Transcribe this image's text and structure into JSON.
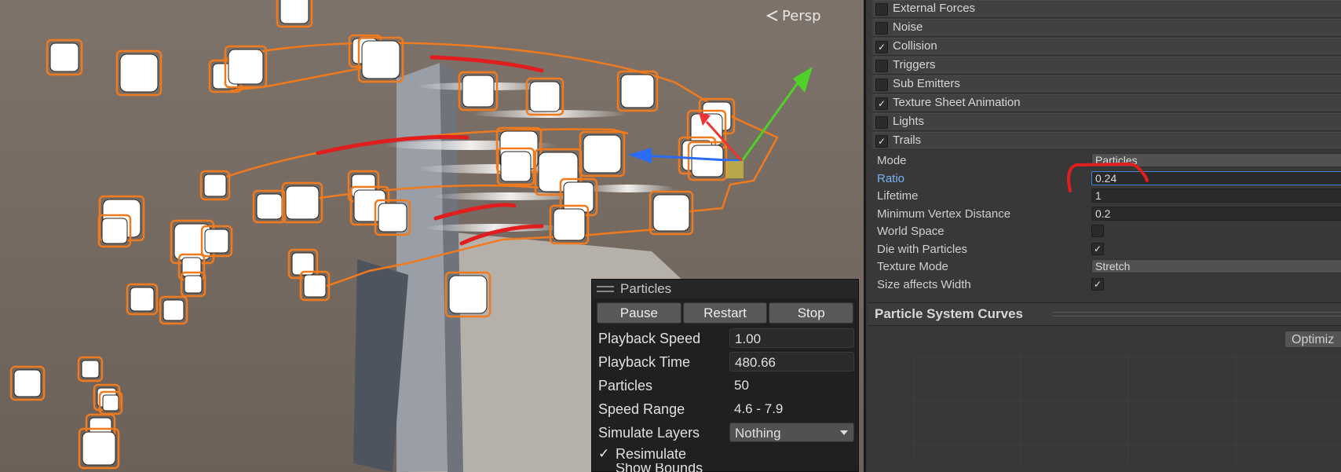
{
  "scene": {
    "view_label": "Persp",
    "icons": [
      "persp-arrow-icon",
      "move-gizmo-icon"
    ]
  },
  "particles_panel": {
    "title": "Particles",
    "buttons": {
      "pause": "Pause",
      "restart": "Restart",
      "stop": "Stop"
    },
    "playback_speed": {
      "label": "Playback Speed",
      "value": "1.00"
    },
    "playback_time": {
      "label": "Playback Time",
      "value": "480.66"
    },
    "particles": {
      "label": "Particles",
      "value": "50"
    },
    "speed_range": {
      "label": "Speed Range",
      "value": "4.6 - 7.9"
    },
    "simulate_layers": {
      "label": "Simulate Layers",
      "value": "Nothing"
    },
    "resimulate": {
      "label": "Resimulate",
      "checked": true
    },
    "show_bounds": {
      "label": "Show Bounds"
    }
  },
  "inspector": {
    "modules": [
      {
        "label": "External Forces",
        "checked": false
      },
      {
        "label": "Noise",
        "checked": false
      },
      {
        "label": "Collision",
        "checked": true
      },
      {
        "label": "Triggers",
        "checked": false
      },
      {
        "label": "Sub Emitters",
        "checked": false
      },
      {
        "label": "Texture Sheet Animation",
        "checked": true
      },
      {
        "label": "Lights",
        "checked": false
      },
      {
        "label": "Trails",
        "checked": true
      }
    ],
    "trails": {
      "mode": {
        "label": "Mode",
        "value": "Particles"
      },
      "ratio": {
        "label": "Ratio",
        "value": "0.24"
      },
      "lifetime": {
        "label": "Lifetime",
        "value": "1"
      },
      "min_vertex_distance": {
        "label": "Minimum Vertex Distance",
        "value": "0.2"
      },
      "world_space": {
        "label": "World Space",
        "checked": false
      },
      "die_with_particles": {
        "label": "Die with Particles",
        "checked": true
      },
      "texture_mode": {
        "label": "Texture Mode",
        "value": "Stretch"
      },
      "size_affects_width": {
        "label": "Size affects Width",
        "checked": true
      }
    },
    "curves_title": "Particle System Curves",
    "optimize_label": "Optimiz"
  },
  "colors": {
    "scene_bg": "#7a6f66",
    "selection_orange": "#f07a1e",
    "annotation_red": "#e01e1e",
    "selected_blue": "#3c82d4"
  }
}
